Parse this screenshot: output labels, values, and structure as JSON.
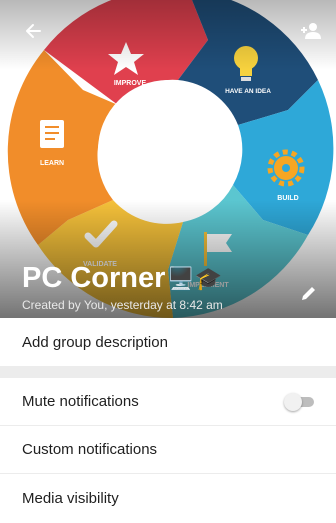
{
  "header": {
    "group_name": "PC Corner",
    "emoji_pc": "🖥️",
    "emoji_cap": "🎓",
    "created_text": "Created by You, yesterday at 8:42 am",
    "back_icon": "arrow-left-icon",
    "add_icon": "add-person-icon",
    "edit_icon": "pencil-icon",
    "wheel_labels": {
      "improve": "IMPROVE",
      "idea": "HAVE AN IDEA",
      "build": "BUILD",
      "implement": "IMPLEMENT",
      "validate": "VALIDATE",
      "learn": "LEARN"
    },
    "wheel_colors": {
      "improve": "#e0404e",
      "idea": "#1f4e79",
      "build": "#2ea8d8",
      "implement": "#5bc6d0",
      "validate": "#f5c13a",
      "learn": "#f18d2a"
    }
  },
  "description": {
    "label": "Add group description"
  },
  "settings": {
    "mute_label": "Mute notifications",
    "mute_on": false,
    "custom_label": "Custom notifications",
    "media_label": "Media visibility"
  }
}
